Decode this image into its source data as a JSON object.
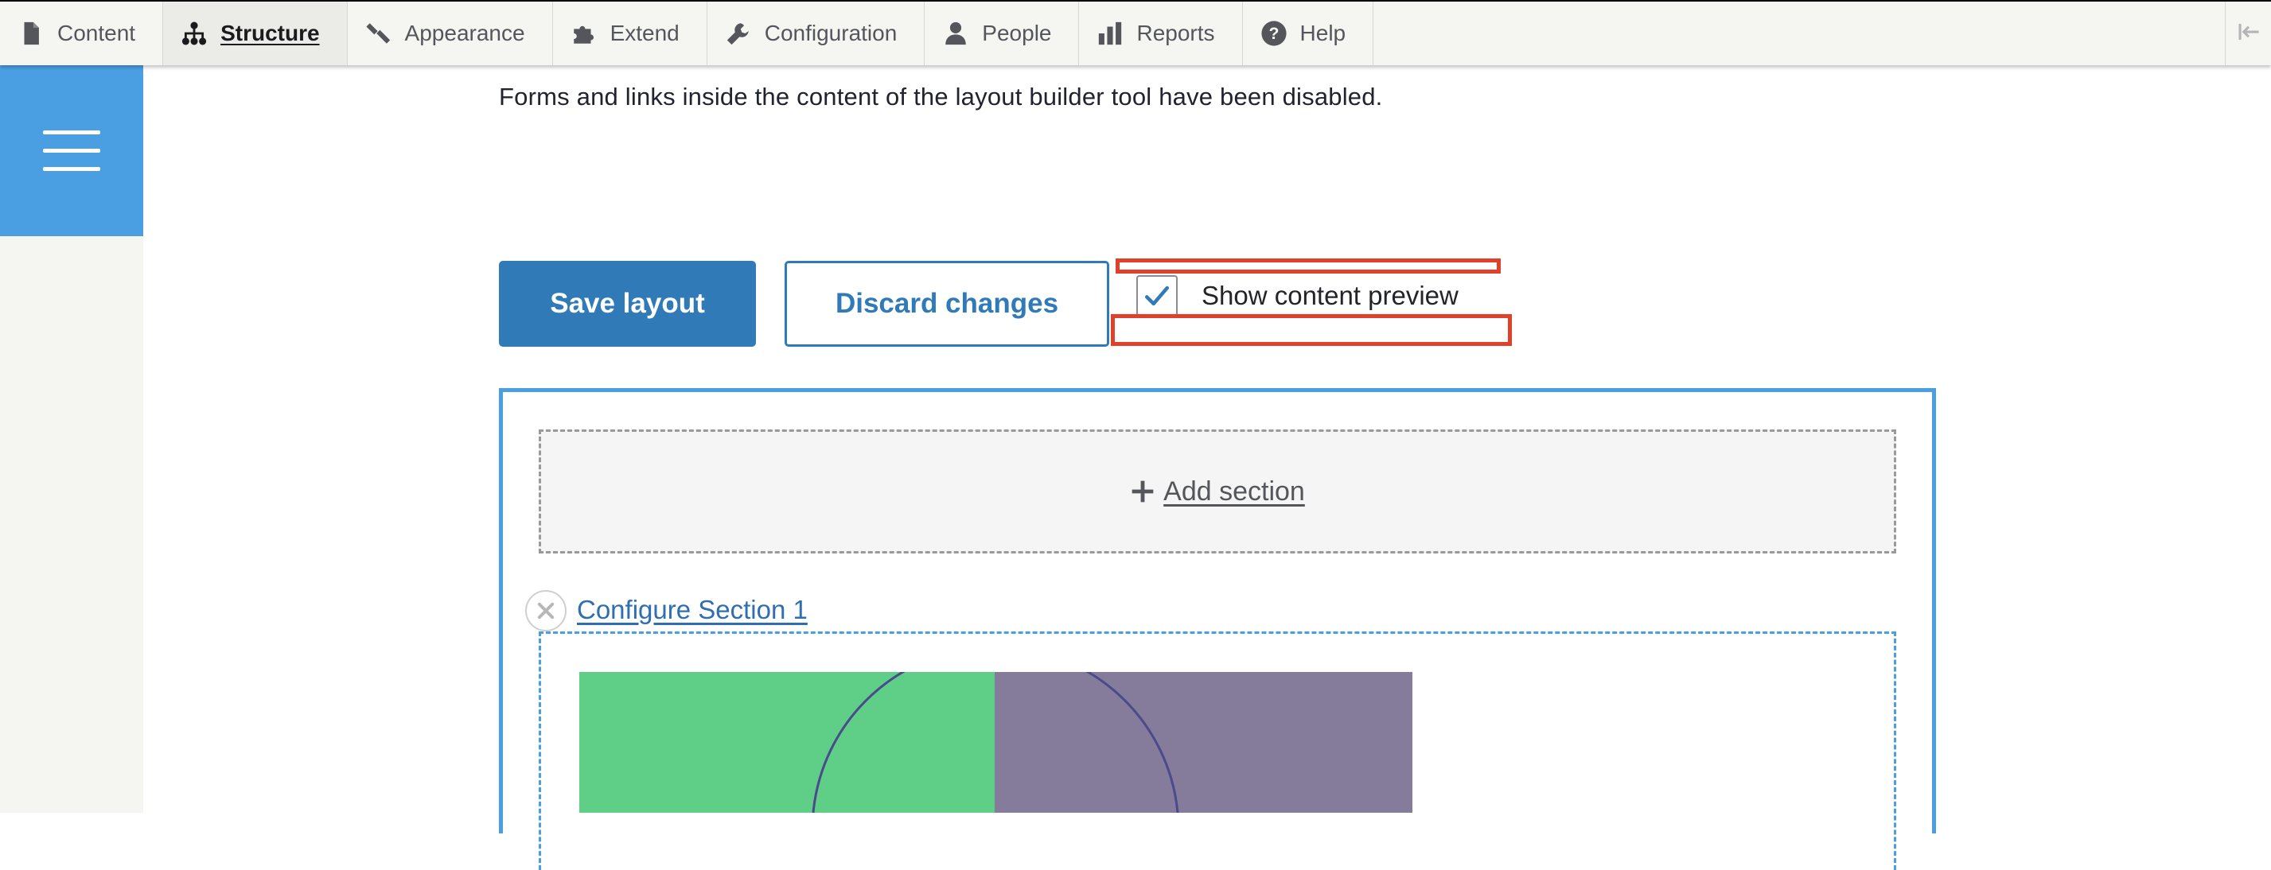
{
  "toolbar": {
    "items": [
      {
        "label": "Content",
        "icon": "file-icon",
        "active": false
      },
      {
        "label": "Structure",
        "icon": "sitemap-icon",
        "active": true
      },
      {
        "label": "Appearance",
        "icon": "paint-brush-icon",
        "active": false
      },
      {
        "label": "Extend",
        "icon": "puzzle-icon",
        "active": false
      },
      {
        "label": "Configuration",
        "icon": "wrench-icon",
        "active": false
      },
      {
        "label": "People",
        "icon": "person-icon",
        "active": false
      },
      {
        "label": "Reports",
        "icon": "bar-chart-icon",
        "active": false
      },
      {
        "label": "Help",
        "icon": "help-icon",
        "active": false
      }
    ],
    "toggle_icon": "collapse-tray-icon"
  },
  "main": {
    "notice": "Forms and links inside the content of the layout builder tool have been disabled.",
    "save_label": "Save layout",
    "discard_label": "Discard changes",
    "preview_label": "Show content preview",
    "preview_checked": true
  },
  "builder": {
    "add_section_label": "Add section",
    "configure_section_label": "Configure Section 1"
  },
  "colors": {
    "accent": "#2f7ab7",
    "menu": "#4a9fe3",
    "highlight": "#e0412a",
    "image_green": "#5fcf88",
    "image_purple": "#857b9b"
  }
}
